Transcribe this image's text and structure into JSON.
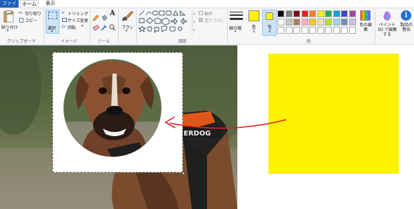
{
  "tabs": {
    "file": "ファイル",
    "home": "ホーム",
    "view": "表示"
  },
  "clipboard": {
    "paste": "貼り付け",
    "cut": "切り取り",
    "copy": "コピー",
    "group_label": "クリップボード"
  },
  "image": {
    "select": "選択",
    "crop": "トリミング",
    "resize": "サイズ変更",
    "rotate": "回転",
    "group_label": "イメージ"
  },
  "tools": {
    "text_glyph": "A",
    "group_label": "ツール"
  },
  "brush": {
    "label": "ブラシ"
  },
  "shapes": {
    "outline": "輪郭",
    "fill": "塗りつぶし",
    "group_label": "図形"
  },
  "size": {
    "label": "線の幅"
  },
  "colors": {
    "color1_label": "色",
    "color1_num": "1",
    "color2_label": "色",
    "color2_num": "2",
    "group_label": "色",
    "edit_label": "色の編集",
    "color1": "#fff200",
    "color2": "#fff200",
    "palette_row1": [
      "#000000",
      "#7f7f7f",
      "#880015",
      "#ed1c24",
      "#ff7f27",
      "#fff200",
      "#22b14c",
      "#00a2e8",
      "#3f48cc",
      "#a349a4"
    ],
    "palette_row2": [
      "#ffffff",
      "#c3c3c3",
      "#b97a57",
      "#ffaec9",
      "#ffc90e",
      "#efe4b0",
      "#b5e61d",
      "#99d9ea",
      "#7092be",
      "#c8bfe7"
    ]
  },
  "paint3d": {
    "label": "ペイント 3D で編集する"
  },
  "alert": {
    "label": "製品の警告"
  },
  "canvas": {
    "harness_text": "ERDOG",
    "yellow_color": "#fff200",
    "arrow_color": "#e11f26"
  }
}
